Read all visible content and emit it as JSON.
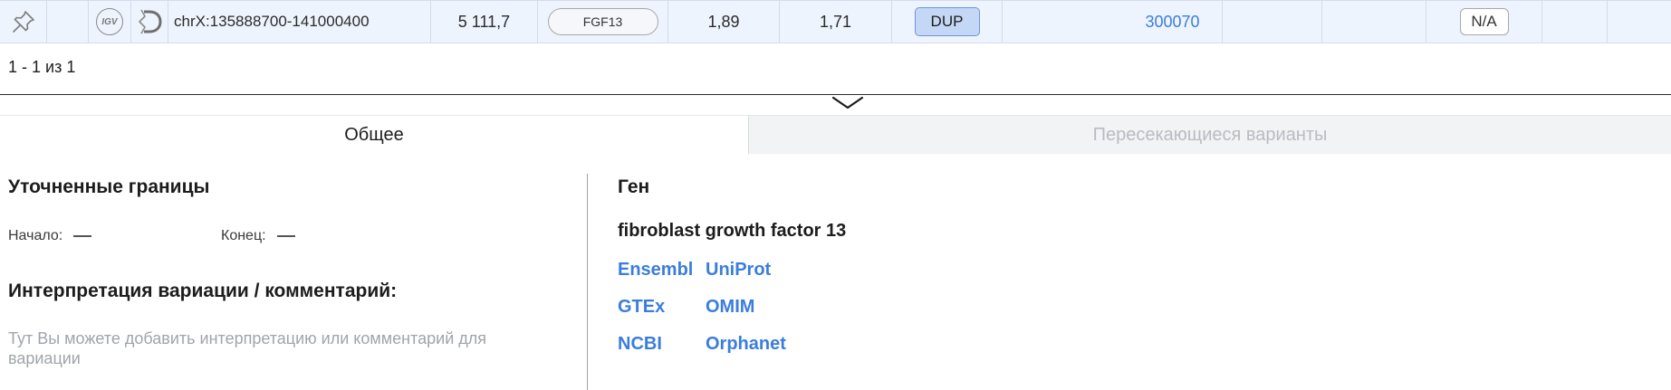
{
  "row": {
    "igv_label": "IGV",
    "location": "chrX:135888700-141000400",
    "size": "5 111,7",
    "gene": "FGF13",
    "value1": "1,89",
    "value2": "1,71",
    "type": "DUP",
    "omim": "300070",
    "na": "N/A"
  },
  "pagination": "1 - 1 из 1",
  "tabs": {
    "general": "Общее",
    "overlapping": "Пересекающиеся варианты"
  },
  "left": {
    "refined_title": "Уточненные границы",
    "start_label": "Начало:",
    "end_label": "Конец:",
    "interpretation_title": "Интерпретация вариации / комментарий:",
    "placeholder": "Тут Вы можете добавить интерпретацию или комментарий для вариации"
  },
  "right": {
    "gene_heading": "Ген",
    "gene_full_name": "fibroblast growth factor 13",
    "links": {
      "ensembl": "Ensembl",
      "uniprot": "UniProt",
      "gtex": "GTEx",
      "omim": "OMIM",
      "ncbi": "NCBI",
      "orphanet": "Orphanet"
    }
  },
  "icons": [
    "pin-icon",
    "igv-icon",
    "decipher-icon",
    "chevron-down-icon"
  ],
  "colors": {
    "row_bg": "#eef4fd",
    "link": "#3b7ddd",
    "dup_badge": "#c4d8f6",
    "tab_inactive_text": "#b8bcc2"
  }
}
